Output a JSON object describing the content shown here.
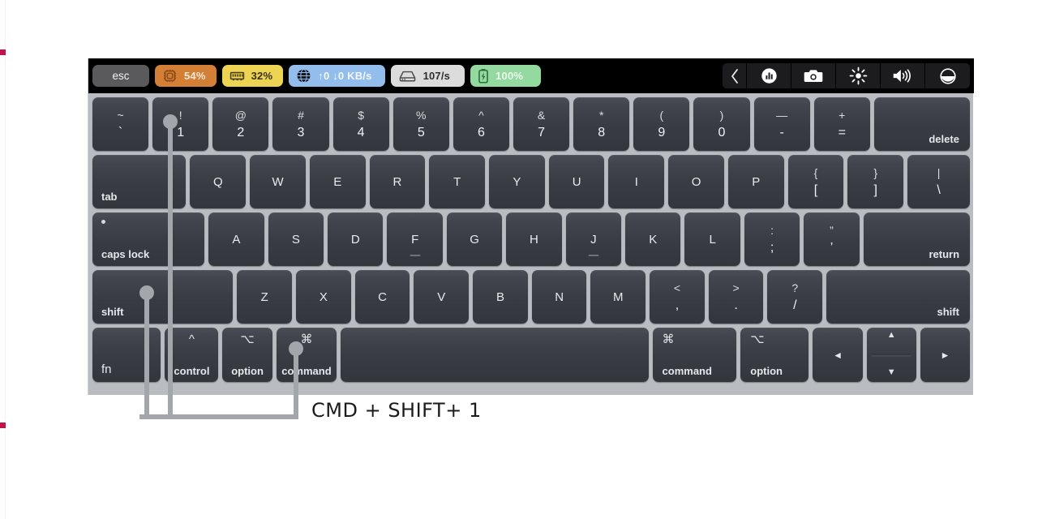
{
  "annotation": {
    "text": "CMD + SHIFT+ 1",
    "targets": [
      "shift-left-key",
      "one-key",
      "command-left-key"
    ]
  },
  "touchbar": {
    "esc_label": "esc",
    "widgets": [
      {
        "id": "cpu",
        "icon": "cpu-chip-icon",
        "value": "54%",
        "color": "#d38036"
      },
      {
        "id": "memory",
        "icon": "memory-ram-icon",
        "value": "32%",
        "color": "#edd453"
      },
      {
        "id": "network",
        "icon": "globe-icon",
        "value": "↑0 ↓0 KB/s",
        "color": "#93bdec"
      },
      {
        "id": "disk",
        "icon": "hard-drive-icon",
        "value": "107/s",
        "color": "#dcdcdc"
      },
      {
        "id": "battery",
        "icon": "battery-bolt-icon",
        "value": "100%",
        "color": "#93d9a0"
      }
    ],
    "controls": [
      {
        "id": "back",
        "icon": "chevron-left-icon"
      },
      {
        "id": "stats",
        "icon": "bar-chart-circle-icon"
      },
      {
        "id": "screenshot",
        "icon": "camera-icon"
      },
      {
        "id": "brightness",
        "icon": "brightness-sun-icon"
      },
      {
        "id": "volume",
        "icon": "speaker-volume-icon"
      },
      {
        "id": "dnd",
        "icon": "do-not-disturb-icon"
      }
    ]
  },
  "keyboard": {
    "rows": [
      {
        "id": "number-row",
        "keys": [
          {
            "id": "grave",
            "up": "~",
            "lo": "`"
          },
          {
            "id": "one",
            "up": "!",
            "lo": "1"
          },
          {
            "id": "two",
            "up": "@",
            "lo": "2"
          },
          {
            "id": "three",
            "up": "#",
            "lo": "3"
          },
          {
            "id": "four",
            "up": "$",
            "lo": "4"
          },
          {
            "id": "five",
            "up": "%",
            "lo": "5"
          },
          {
            "id": "six",
            "up": "^",
            "lo": "6"
          },
          {
            "id": "seven",
            "up": "&",
            "lo": "7"
          },
          {
            "id": "eight",
            "up": "*",
            "lo": "8"
          },
          {
            "id": "nine",
            "up": "(",
            "lo": "9"
          },
          {
            "id": "zero",
            "up": ")",
            "lo": "0"
          },
          {
            "id": "minus",
            "up": "—",
            "lo": "-"
          },
          {
            "id": "equal",
            "up": "+",
            "lo": "="
          },
          {
            "id": "delete",
            "corner": "delete"
          }
        ]
      },
      {
        "id": "qwerty-row",
        "keys": [
          {
            "id": "tab",
            "corner": "tab"
          },
          {
            "id": "q",
            "lo": "Q"
          },
          {
            "id": "w",
            "lo": "W"
          },
          {
            "id": "e",
            "lo": "E"
          },
          {
            "id": "r",
            "lo": "R"
          },
          {
            "id": "t",
            "lo": "T"
          },
          {
            "id": "y",
            "lo": "Y"
          },
          {
            "id": "u",
            "lo": "U"
          },
          {
            "id": "i",
            "lo": "I"
          },
          {
            "id": "o",
            "lo": "O"
          },
          {
            "id": "p",
            "lo": "P"
          },
          {
            "id": "bracket-left",
            "up": "{",
            "lo": "["
          },
          {
            "id": "bracket-right",
            "up": "}",
            "lo": "]"
          },
          {
            "id": "backslash",
            "up": "|",
            "lo": "\\"
          }
        ]
      },
      {
        "id": "home-row",
        "keys": [
          {
            "id": "caps-lock",
            "corner": "caps lock"
          },
          {
            "id": "a",
            "lo": "A"
          },
          {
            "id": "s",
            "lo": "S"
          },
          {
            "id": "d",
            "lo": "D"
          },
          {
            "id": "f",
            "lo": "F"
          },
          {
            "id": "g",
            "lo": "G"
          },
          {
            "id": "h",
            "lo": "H"
          },
          {
            "id": "j",
            "lo": "J"
          },
          {
            "id": "k",
            "lo": "K"
          },
          {
            "id": "l",
            "lo": "L"
          },
          {
            "id": "semicolon",
            "up": ":",
            "lo": ";"
          },
          {
            "id": "quote",
            "up": "”",
            "lo": "’"
          },
          {
            "id": "return",
            "corner": "return"
          }
        ]
      },
      {
        "id": "shift-row",
        "keys": [
          {
            "id": "shift-left",
            "corner": "shift"
          },
          {
            "id": "z",
            "lo": "Z"
          },
          {
            "id": "x",
            "lo": "X"
          },
          {
            "id": "c",
            "lo": "C"
          },
          {
            "id": "v",
            "lo": "V"
          },
          {
            "id": "b",
            "lo": "B"
          },
          {
            "id": "n",
            "lo": "N"
          },
          {
            "id": "m",
            "lo": "M"
          },
          {
            "id": "comma",
            "up": "<",
            "lo": ","
          },
          {
            "id": "period",
            "up": ">",
            "lo": "."
          },
          {
            "id": "slash",
            "up": "?",
            "lo": "/"
          },
          {
            "id": "shift-right",
            "corner": "shift"
          }
        ]
      },
      {
        "id": "modifier-row",
        "keys": [
          {
            "id": "fn",
            "corner": "fn"
          },
          {
            "id": "control",
            "sym": "^",
            "nm": "control"
          },
          {
            "id": "option-left",
            "sym": "⌥",
            "nm": "option"
          },
          {
            "id": "command-left",
            "sym": "⌘",
            "nm": "command"
          },
          {
            "id": "space"
          },
          {
            "id": "command-right",
            "sym": "⌘",
            "nm": "command"
          },
          {
            "id": "option-right",
            "sym": "⌥",
            "nm": "option"
          },
          {
            "id": "arrow-left",
            "lo": "◄"
          },
          {
            "id": "arrow-updown",
            "up": "▲",
            "lo": "▼"
          },
          {
            "id": "arrow-right",
            "lo": "►"
          }
        ]
      }
    ]
  },
  "colors": {
    "keycap": "#3c3f46",
    "keyboard_frame": "#b9bcc0",
    "touchbar_bg": "#000000",
    "callout": "#a3a6aa",
    "annotation_text": "#1b1b1b",
    "edge_mark": "#c2124a"
  }
}
